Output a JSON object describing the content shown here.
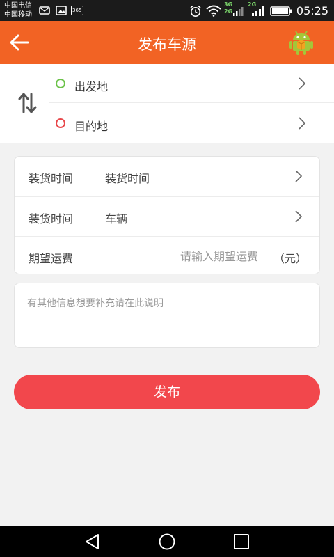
{
  "status_bar": {
    "carrier_1": "中国电信",
    "carrier_2": "中国移动",
    "notif_badge": "365",
    "net_top": "3G",
    "net_bottom": "2G",
    "net_right": "2G",
    "time": "05:25"
  },
  "header": {
    "title": "发布车源",
    "back_icon": "back-arrow-icon",
    "menu_icon": "android-icon"
  },
  "route": {
    "origin_label": "出发地",
    "destination_label": "目的地",
    "origin_dot_color": "#6cc24a",
    "destination_dot_color": "#e8474a"
  },
  "form": {
    "rows": [
      {
        "label": "装货时间",
        "value": "装货时间"
      },
      {
        "label": "装货时间",
        "value": "车辆"
      }
    ],
    "fee_label": "期望运费",
    "fee_placeholder": "请输入期望运费",
    "fee_unit": "（元）"
  },
  "note": {
    "placeholder": "有其他信息想要补充请在此说明"
  },
  "publish_button": "发布",
  "colors": {
    "header_bg": "#f26324",
    "publish_bg": "#f2474c"
  }
}
